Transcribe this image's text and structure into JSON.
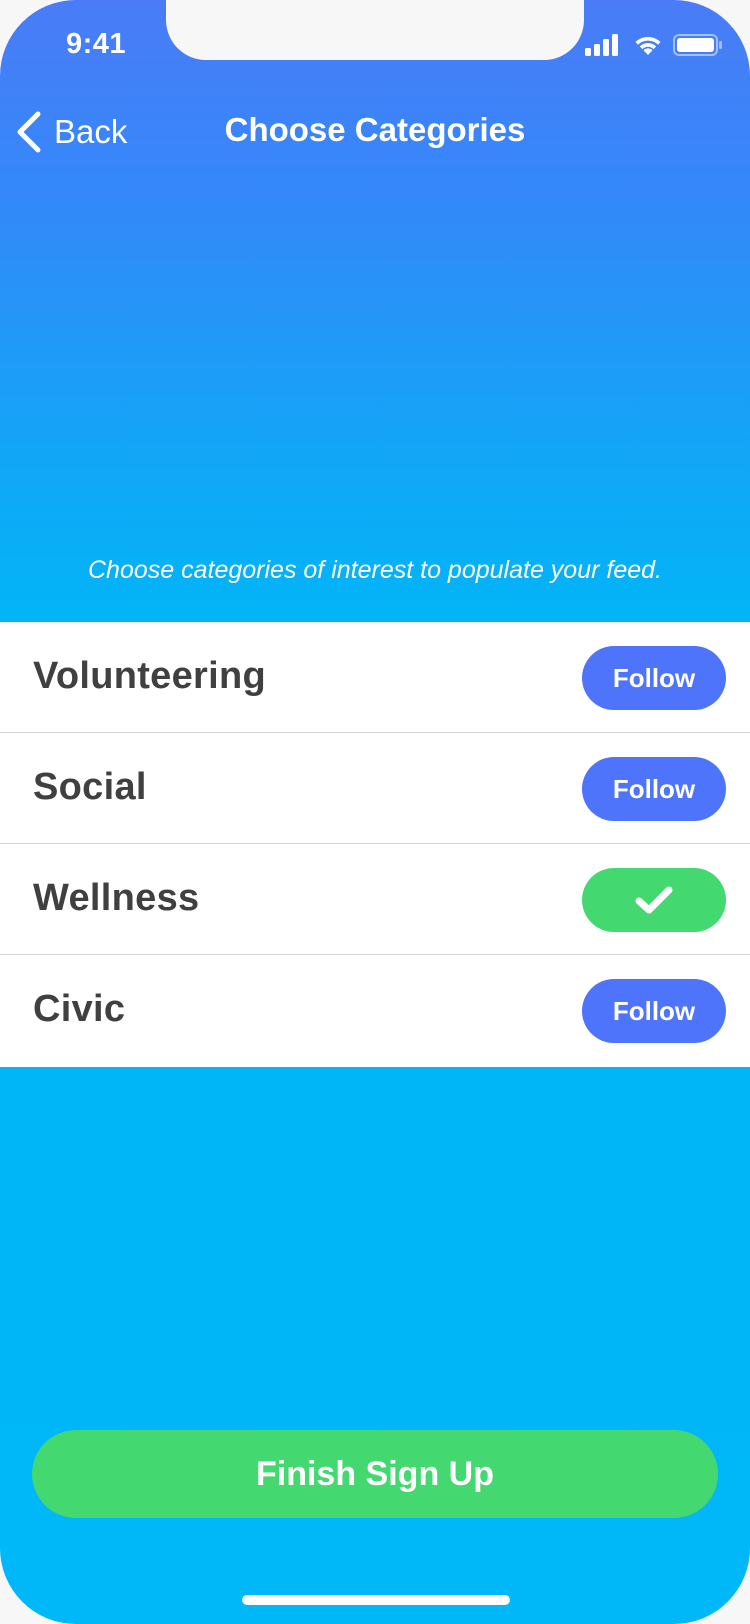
{
  "status_bar": {
    "time": "9:41",
    "signal_icon": "cellular-signal-icon",
    "wifi_icon": "wifi-icon",
    "battery_icon": "battery-icon"
  },
  "nav": {
    "back_label": "Back",
    "back_icon": "chevron-left-icon",
    "title": "Choose Categories"
  },
  "subtitle": "Choose categories of interest to populate your feed.",
  "categories": [
    {
      "name": "Volunteering",
      "button_label": "Follow",
      "followed": false
    },
    {
      "name": "Social",
      "button_label": "Follow",
      "followed": false
    },
    {
      "name": "Wellness",
      "button_label": "",
      "followed": true,
      "icon": "checkmark-icon"
    },
    {
      "name": "Civic",
      "button_label": "Follow",
      "followed": false
    }
  ],
  "finish_button_label": "Finish Sign Up",
  "colors": {
    "gradient_top": "#4a7cf8",
    "gradient_bottom": "#00b7f7",
    "follow_button": "#4d74fa",
    "followed_button": "#43d870",
    "finish_button": "#43d870",
    "category_text": "#404040"
  }
}
